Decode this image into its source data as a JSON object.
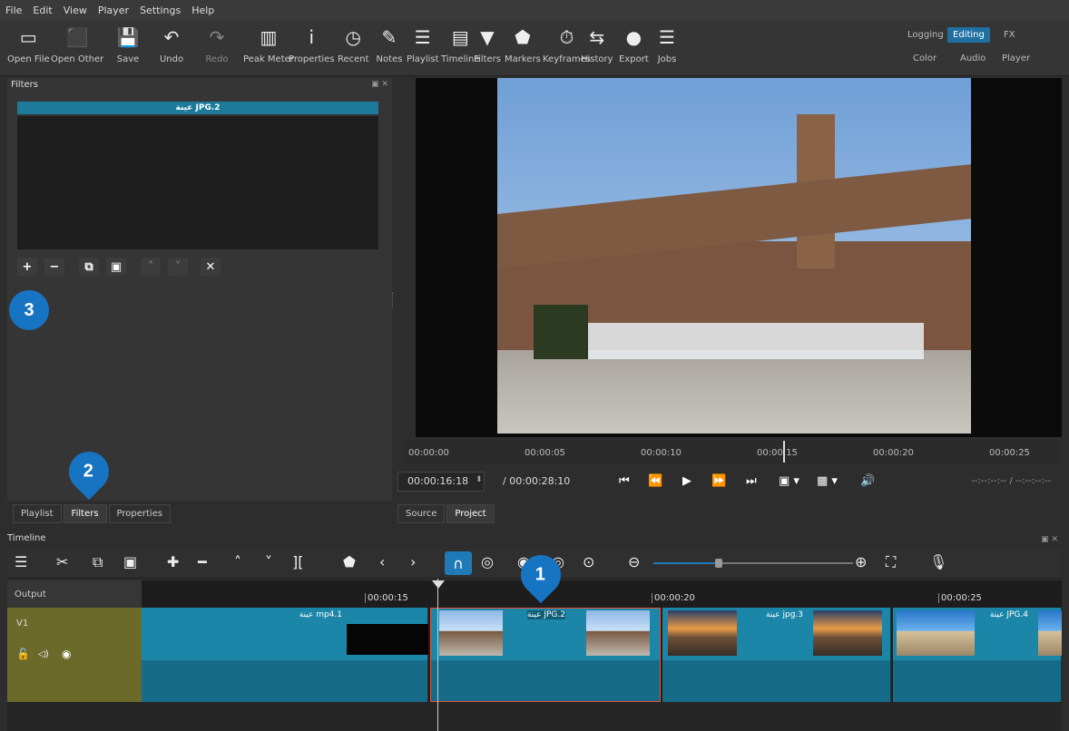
{
  "menu": [
    "File",
    "Edit",
    "View",
    "Player",
    "Settings",
    "Help"
  ],
  "toolbar": [
    {
      "label": "Open File",
      "icon": "folder-icon",
      "glyph": "▭"
    },
    {
      "label": "Open Other",
      "icon": "open-other-icon",
      "glyph": "⬛"
    },
    {
      "label": "Save",
      "icon": "save-icon",
      "glyph": "💾"
    },
    {
      "label": "Undo",
      "icon": "undo-icon",
      "glyph": "↶"
    },
    {
      "label": "Redo",
      "icon": "redo-icon",
      "glyph": "↷"
    },
    {
      "label": "Peak Meter",
      "icon": "peak-meter-icon",
      "glyph": "▥"
    },
    {
      "label": "Properties",
      "icon": "info-icon",
      "glyph": "i"
    },
    {
      "label": "Recent",
      "icon": "clock-icon",
      "glyph": "◷"
    },
    {
      "label": "Notes",
      "icon": "notes-icon",
      "glyph": "✎"
    },
    {
      "label": "Playlist",
      "icon": "list-icon",
      "glyph": "☰"
    },
    {
      "label": "Timeline",
      "icon": "timeline-icon",
      "glyph": "▤"
    },
    {
      "label": "Filters",
      "icon": "funnel-icon",
      "glyph": "▼"
    },
    {
      "label": "Markers",
      "icon": "marker-icon",
      "glyph": "⬟"
    },
    {
      "label": "Keyframes",
      "icon": "stopwatch-icon",
      "glyph": "⏱"
    },
    {
      "label": "History",
      "icon": "history-icon",
      "glyph": "⇆"
    },
    {
      "label": "Export",
      "icon": "export-disc-icon",
      "glyph": "●"
    },
    {
      "label": "Jobs",
      "icon": "jobs-stack-icon",
      "glyph": "☰"
    }
  ],
  "layouts": {
    "logging": "Logging",
    "editing": "Editing",
    "fx": "FX",
    "color": "Color",
    "audio": "Audio",
    "player": "Player"
  },
  "filters_panel": {
    "title": "Filters",
    "clip_name": "عينة JPG.2",
    "tools": [
      {
        "icon": "add-filter-icon",
        "glyph": "+"
      },
      {
        "icon": "remove-filter-icon",
        "glyph": "−"
      },
      {
        "icon": "copy-filter-icon",
        "glyph": "⧉"
      },
      {
        "icon": "paste-filter-icon",
        "glyph": "▣"
      },
      {
        "icon": "move-up-icon",
        "glyph": "˄"
      },
      {
        "icon": "move-down-icon",
        "glyph": "˅"
      },
      {
        "icon": "deselect-filter-icon",
        "glyph": "✕"
      }
    ]
  },
  "left_tabs": [
    "Playlist",
    "Filters",
    "Properties"
  ],
  "player_tabs": [
    "Source",
    "Project"
  ],
  "player_ruler": [
    "00:00:00",
    "00:00:05",
    "00:00:10",
    "00:00:15",
    "00:00:20",
    "00:00:25"
  ],
  "transport": {
    "current": "00:00:16:18",
    "total": "/ 00:00:28:10",
    "right": "--:--:--:-- /    --:--:--:--"
  },
  "timeline": {
    "title": "Timeline",
    "output": "Output",
    "track": "V1",
    "ruler": [
      "00:00:15",
      "00:00:20",
      "00:00:25"
    ],
    "clips": [
      {
        "label": "عينة mp4.1"
      },
      {
        "label": "عينة JPG.2"
      },
      {
        "label": "عينة jpg.3"
      },
      {
        "label": "عينة JPG.4"
      }
    ]
  },
  "callouts": [
    "1",
    "2",
    "3"
  ],
  "colors": {
    "accent": "#1f7ab8",
    "callout": "#1774c2",
    "selected": "#e0563a",
    "track": "#6b6a2b"
  }
}
